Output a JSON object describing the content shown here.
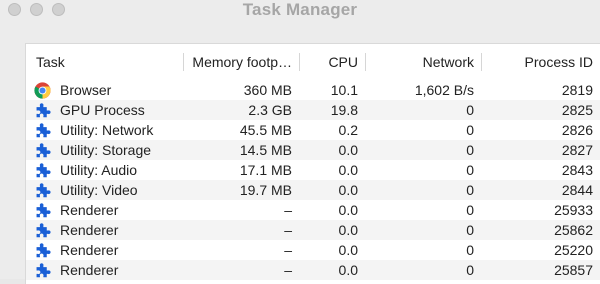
{
  "window": {
    "title": "Task Manager"
  },
  "table": {
    "columns": [
      "Task",
      "Memory footp…",
      "CPU",
      "Network",
      "Process ID"
    ],
    "rows": [
      {
        "icon": "chrome-icon",
        "task": "Browser",
        "memory": "360 MB",
        "cpu": "10.1",
        "network": "1,602 B/s",
        "pid": "2819"
      },
      {
        "icon": "puzzle-icon",
        "task": "GPU Process",
        "memory": "2.3 GB",
        "cpu": "19.8",
        "network": "0",
        "pid": "2825"
      },
      {
        "icon": "puzzle-icon",
        "task": "Utility: Network",
        "memory": "45.5 MB",
        "cpu": "0.2",
        "network": "0",
        "pid": "2826"
      },
      {
        "icon": "puzzle-icon",
        "task": "Utility: Storage",
        "memory": "14.5 MB",
        "cpu": "0.0",
        "network": "0",
        "pid": "2827"
      },
      {
        "icon": "puzzle-icon",
        "task": "Utility: Audio",
        "memory": "17.1 MB",
        "cpu": "0.0",
        "network": "0",
        "pid": "2843"
      },
      {
        "icon": "puzzle-icon",
        "task": "Utility: Video",
        "memory": "19.7 MB",
        "cpu": "0.0",
        "network": "0",
        "pid": "2844"
      },
      {
        "icon": "puzzle-icon",
        "task": "Renderer",
        "memory": "–",
        "cpu": "0.0",
        "network": "0",
        "pid": "25933"
      },
      {
        "icon": "puzzle-icon",
        "task": "Renderer",
        "memory": "–",
        "cpu": "0.0",
        "network": "0",
        "pid": "25862"
      },
      {
        "icon": "puzzle-icon",
        "task": "Renderer",
        "memory": "–",
        "cpu": "0.0",
        "network": "0",
        "pid": "25220"
      },
      {
        "icon": "puzzle-icon",
        "task": "Renderer",
        "memory": "–",
        "cpu": "0.0",
        "network": "0",
        "pid": "25857"
      }
    ]
  },
  "colors": {
    "puzzle": "#1a5fd6",
    "stripe": "#f4f4f4",
    "title": "#a6a6a6"
  }
}
